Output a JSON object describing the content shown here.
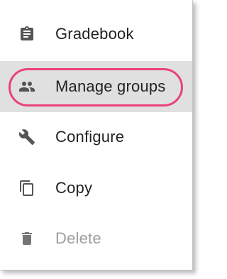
{
  "menu": {
    "items": [
      {
        "label": "Gradebook",
        "icon": "clipboard-icon",
        "highlighted": false,
        "disabled": false
      },
      {
        "label": "Manage groups",
        "icon": "people-icon",
        "highlighted": true,
        "disabled": false
      },
      {
        "label": "Configure",
        "icon": "wrench-icon",
        "highlighted": false,
        "disabled": false
      },
      {
        "label": "Copy",
        "icon": "copy-icon",
        "highlighted": false,
        "disabled": false
      },
      {
        "label": "Delete",
        "icon": "trash-icon",
        "highlighted": false,
        "disabled": true
      }
    ]
  },
  "colors": {
    "highlight_background": "#e0e0e0",
    "annotation_ring": "#e8427c",
    "icon": "#555555",
    "disabled_icon": "#757575",
    "disabled_text": "#9e9e9e"
  }
}
